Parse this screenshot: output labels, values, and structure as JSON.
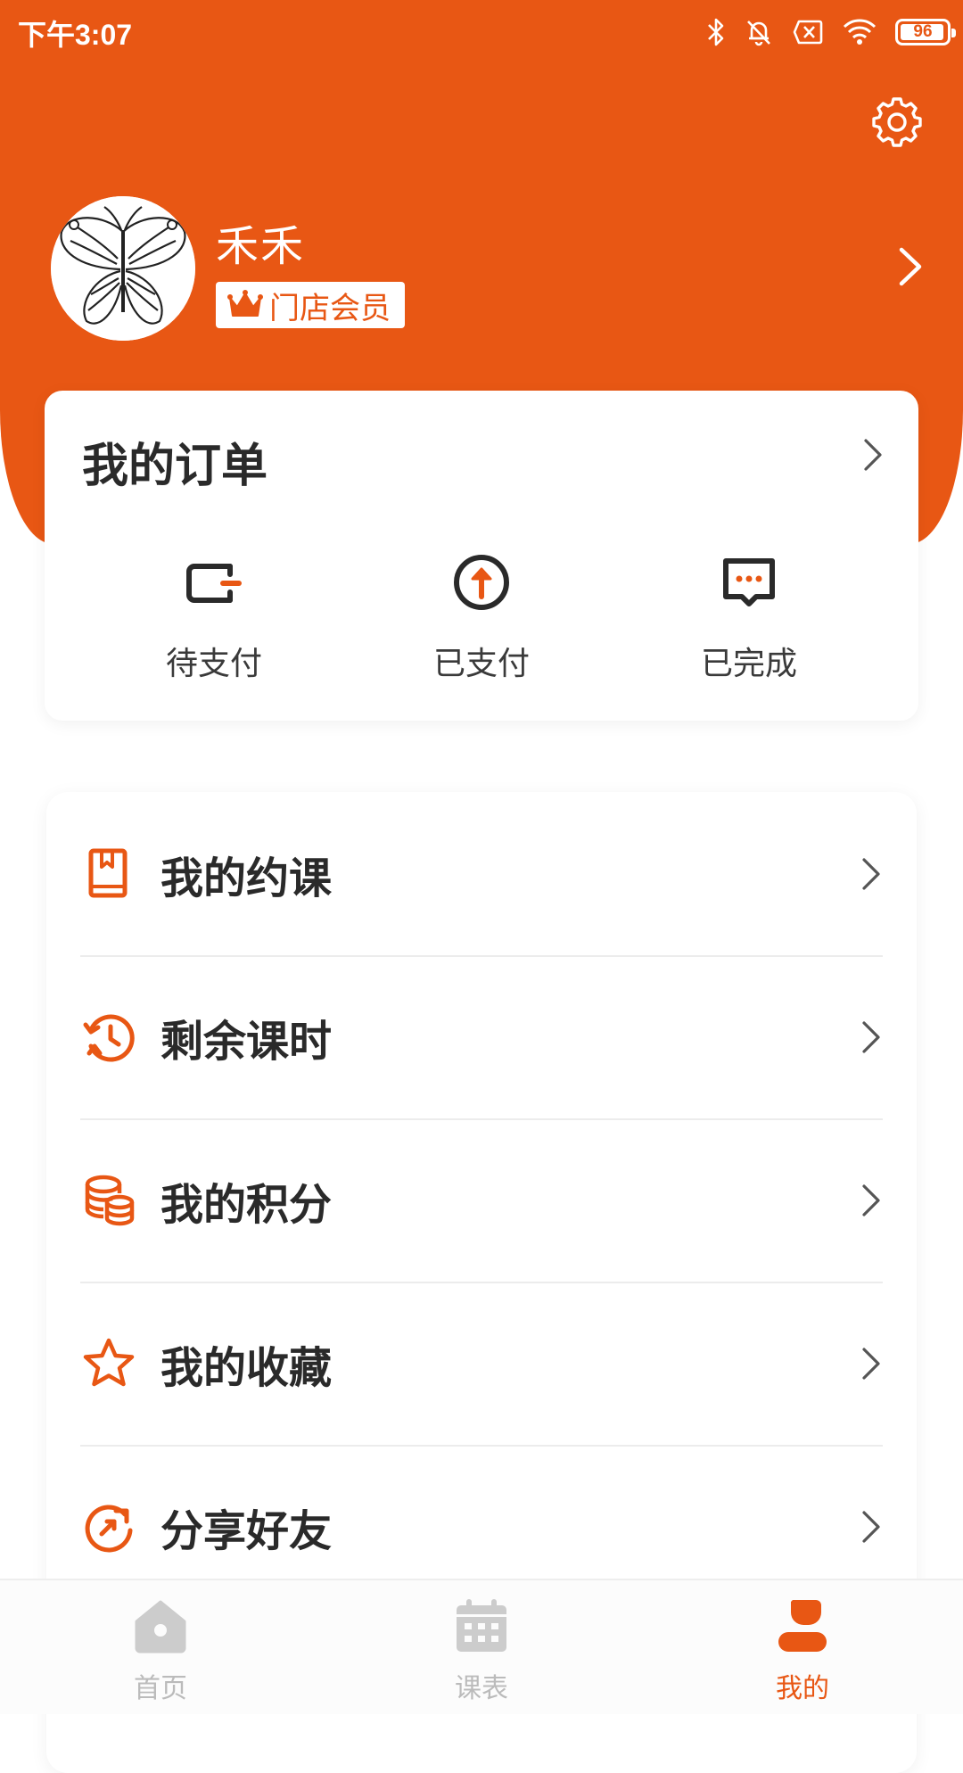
{
  "status_bar": {
    "time": "下午3:07",
    "battery": "96",
    "battery_level": 0.96
  },
  "profile": {
    "name": "禾禾",
    "badge": "门店会员"
  },
  "orders": {
    "title": "我的订单",
    "items": [
      {
        "label": "待支付",
        "icon": "wallet-icon"
      },
      {
        "label": "已支付",
        "icon": "arrow-up-circle-icon"
      },
      {
        "label": "已完成",
        "icon": "message-dots-icon"
      }
    ]
  },
  "menu": {
    "items": [
      {
        "label": "我的约课",
        "icon": "book-icon"
      },
      {
        "label": "剩余课时",
        "icon": "clock-history-icon"
      },
      {
        "label": "我的积分",
        "icon": "coins-stack-icon"
      },
      {
        "label": "我的收藏",
        "icon": "star-icon"
      },
      {
        "label": "分享好友",
        "icon": "share-refresh-icon"
      }
    ]
  },
  "tabs": [
    {
      "label": "首页",
      "icon": "home-icon",
      "active": false
    },
    {
      "label": "课表",
      "icon": "calendar-icon",
      "active": false
    },
    {
      "label": "我的",
      "icon": "user-icon",
      "active": true
    }
  ],
  "colors": {
    "accent": "#e85714",
    "inactive_tab": "#bbbbbb",
    "text": "#2a2a2a"
  }
}
